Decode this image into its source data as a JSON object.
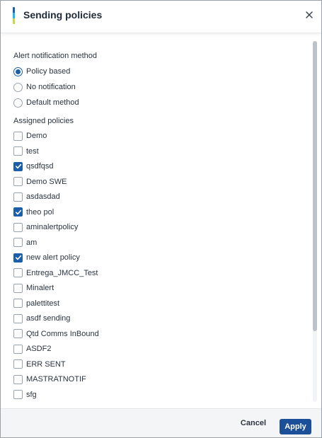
{
  "dialog": {
    "title": "Sending policies",
    "close_icon": "close-icon",
    "accent_colors": [
      "#1b5fa8",
      "#23b7e5",
      "#c8d64a"
    ]
  },
  "alert_method": {
    "label": "Alert notification method",
    "options": [
      {
        "label": "Policy based",
        "selected": true
      },
      {
        "label": "No notification",
        "selected": false
      },
      {
        "label": "Default method",
        "selected": false
      }
    ]
  },
  "assigned_policies": {
    "label": "Assigned policies",
    "items": [
      {
        "label": "Demo",
        "checked": false
      },
      {
        "label": "test",
        "checked": false
      },
      {
        "label": "qsdfqsd",
        "checked": true
      },
      {
        "label": "Demo SWE",
        "checked": false
      },
      {
        "label": "asdasdad",
        "checked": false
      },
      {
        "label": "theo pol",
        "checked": true
      },
      {
        "label": "aminalertpolicy",
        "checked": false
      },
      {
        "label": "am",
        "checked": false
      },
      {
        "label": "new alert policy",
        "checked": true
      },
      {
        "label": "Entrega_JMCC_Test",
        "checked": false
      },
      {
        "label": "Minalert",
        "checked": false
      },
      {
        "label": "palettitest",
        "checked": false
      },
      {
        "label": "asdf sending",
        "checked": false
      },
      {
        "label": "Qtd Comms InBound",
        "checked": false
      },
      {
        "label": "ASDF2",
        "checked": false
      },
      {
        "label": "ERR SENT",
        "checked": false
      },
      {
        "label": "MASTRATNOTIF",
        "checked": false
      },
      {
        "label": "sfg",
        "checked": false
      }
    ]
  },
  "footer": {
    "cancel_label": "Cancel",
    "apply_label": "Apply",
    "apply_color": "#1b4f98"
  }
}
